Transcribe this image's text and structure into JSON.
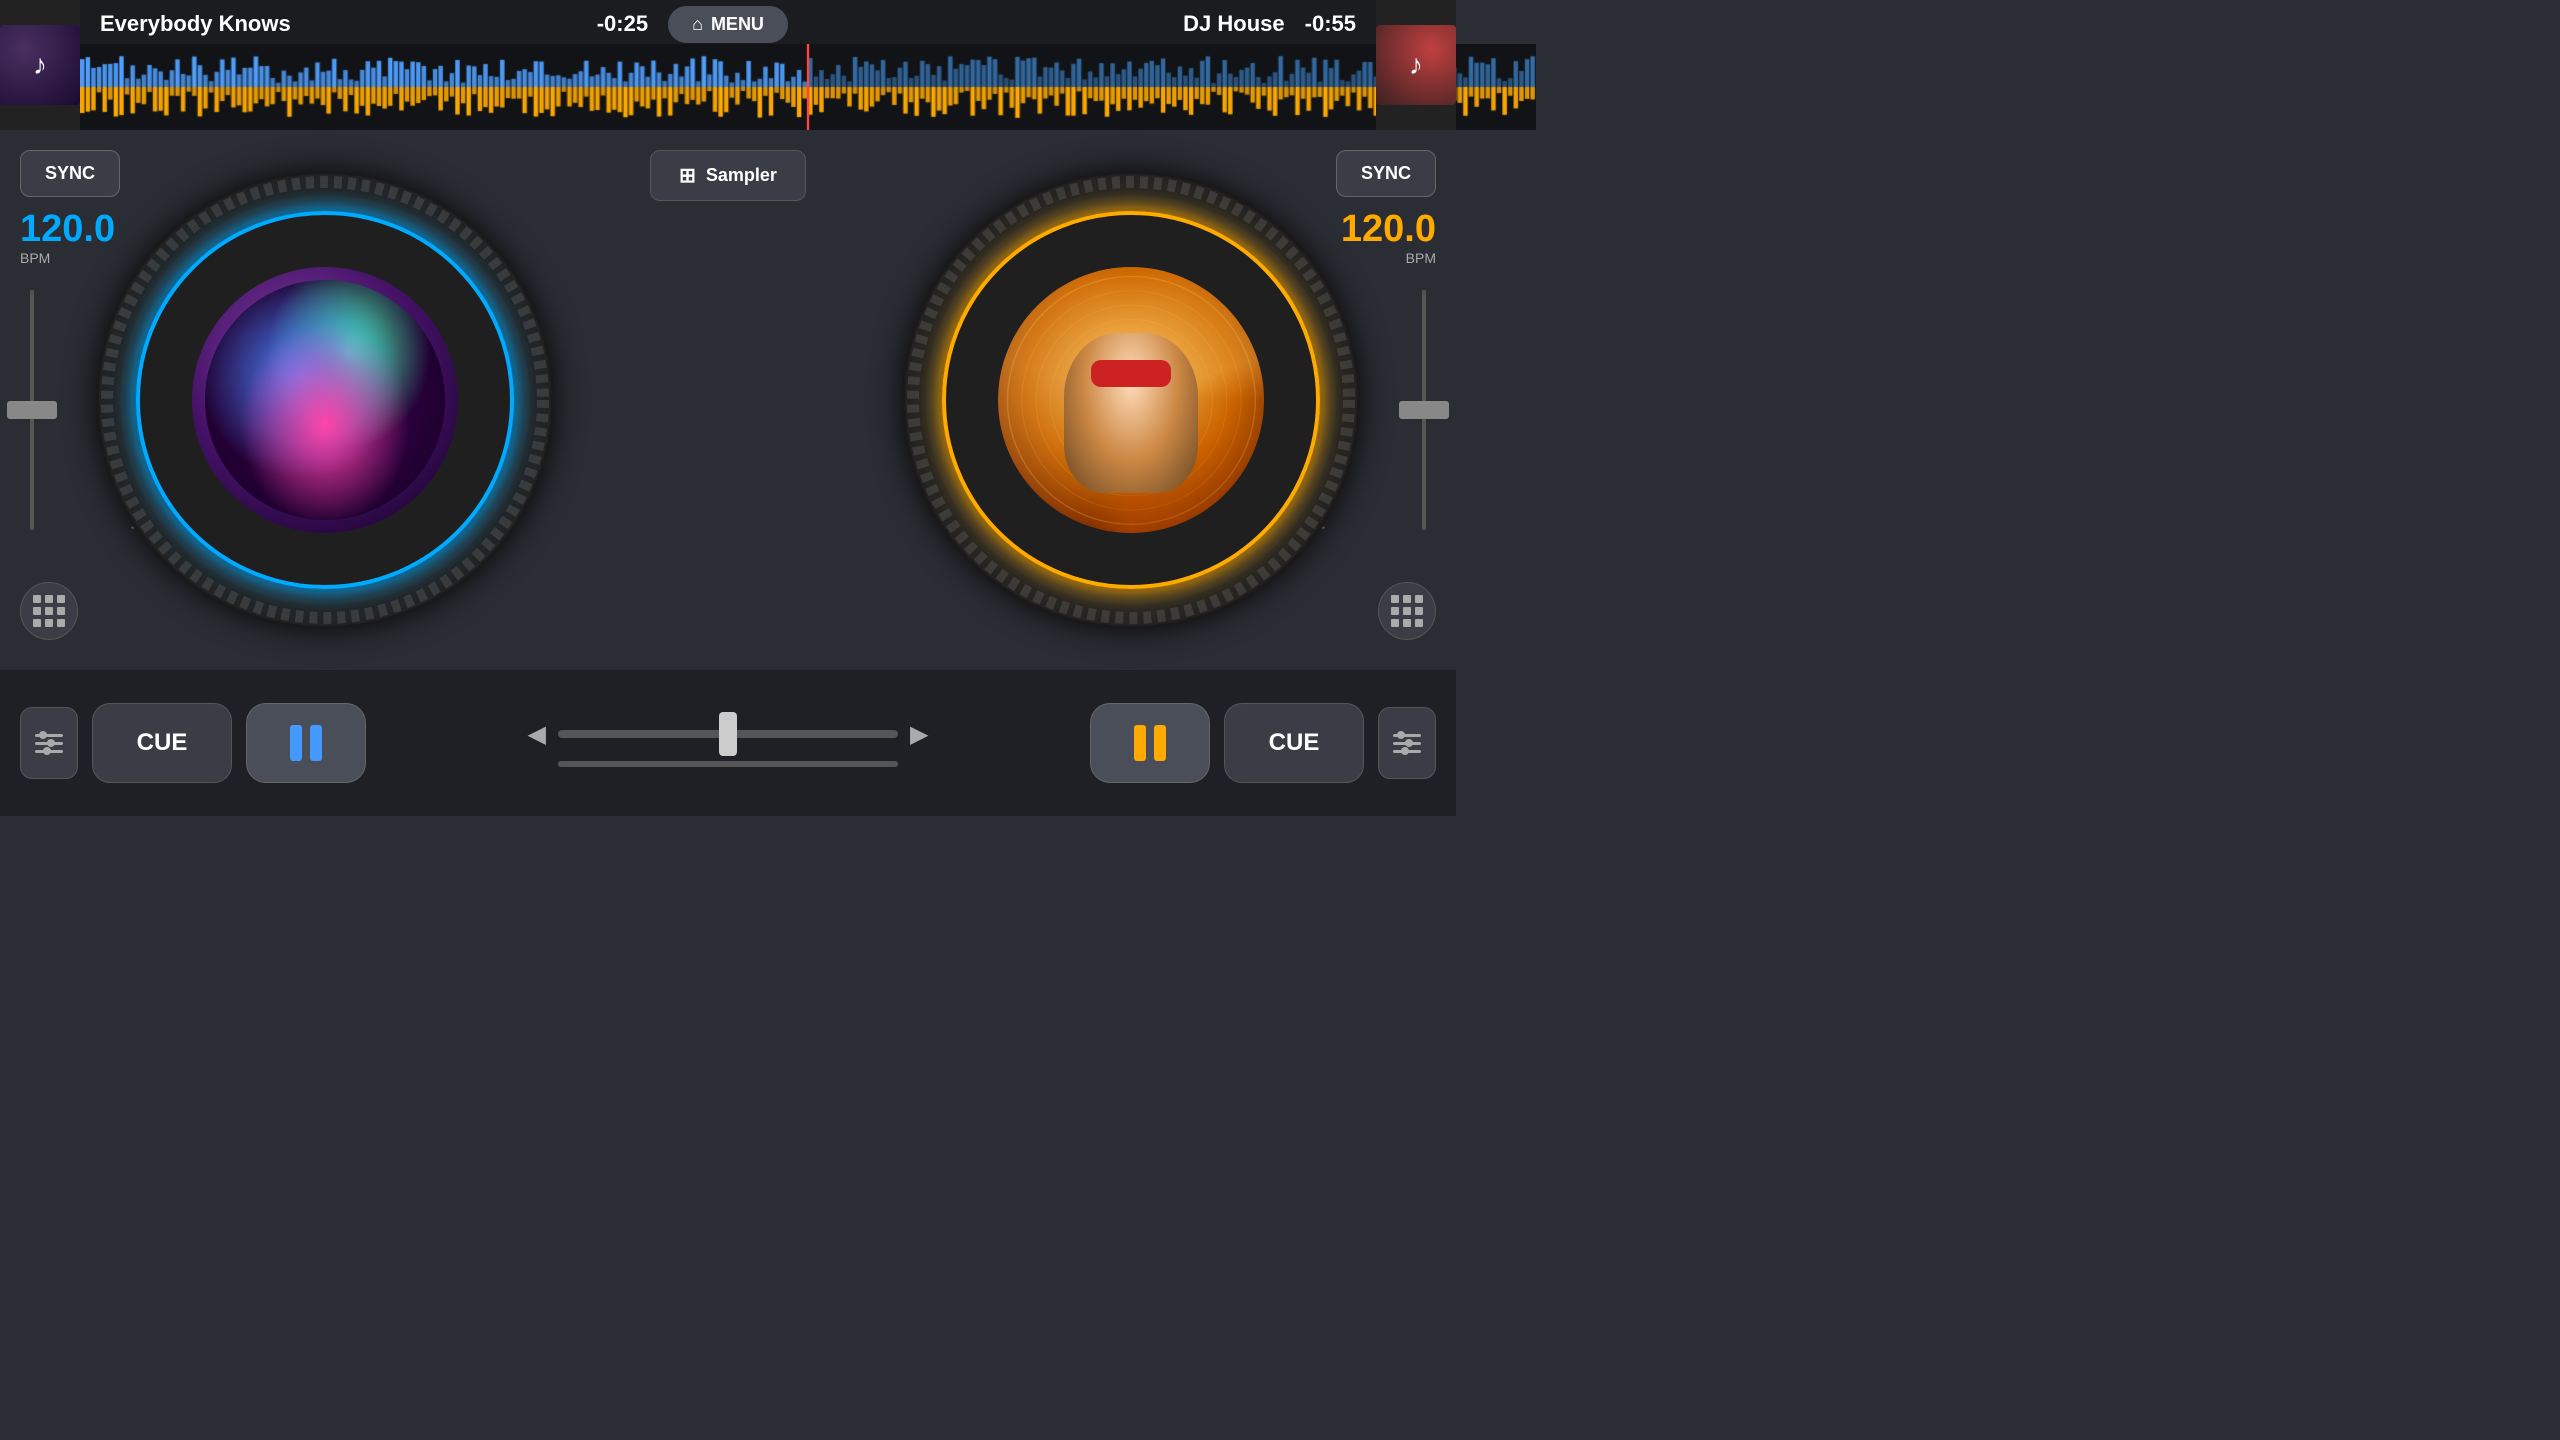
{
  "header": {
    "track_left": "Everybody Knows",
    "time_left": "-0:25",
    "menu_label": "MENU",
    "track_right": "DJ House",
    "time_right": "-0:55"
  },
  "deck_left": {
    "sync_label": "SYNC",
    "bpm_value": "120.0",
    "bpm_label": "BPM",
    "cue_label": "CUE",
    "ring_color": "#00aaff"
  },
  "deck_right": {
    "sync_label": "SYNC",
    "bpm_value": "120.0",
    "bpm_label": "BPM",
    "cue_label": "CUE",
    "ring_color": "#ffaa00"
  },
  "center": {
    "sampler_label": "Sampler"
  },
  "bottom": {
    "cue_left": "CUE",
    "cue_right": "CUE"
  }
}
